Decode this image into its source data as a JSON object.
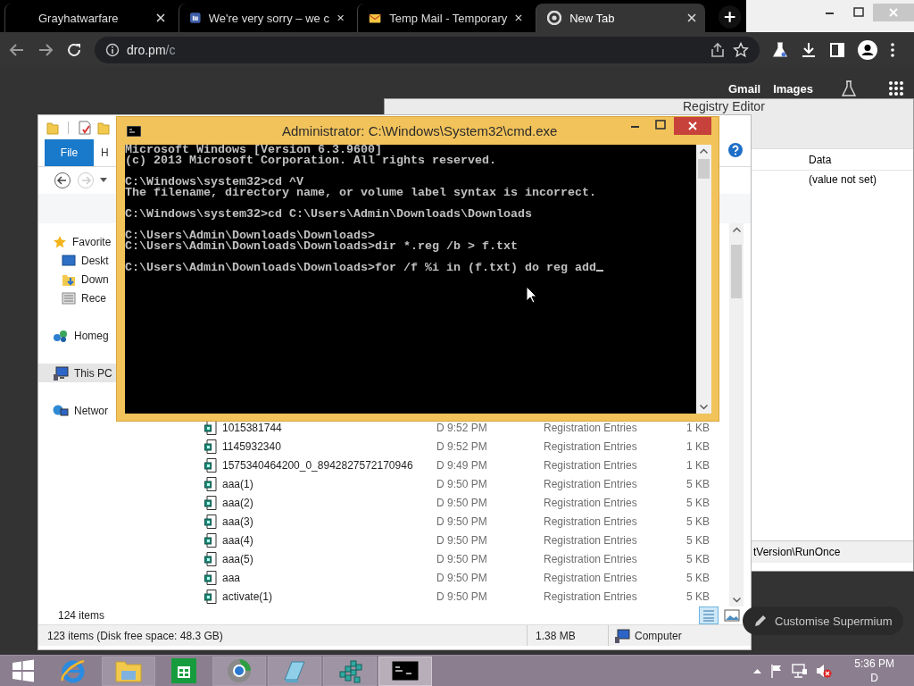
{
  "browser": {
    "tabs": [
      {
        "title": "Grayhatwarfare",
        "kind": "plain",
        "selected": false
      },
      {
        "title": "We're very sorry – we c",
        "kind": "logo",
        "selected": false
      },
      {
        "title": "Temp Mail - Temporary",
        "kind": "mail",
        "selected": false
      },
      {
        "title": "New Tab",
        "kind": "newtab",
        "selected": true
      }
    ],
    "address": {
      "host": "dro.pm",
      "path": "/c"
    },
    "page_links": [
      "Gmail",
      "Images"
    ],
    "customise_button": "Customise Supermium"
  },
  "registry_editor": {
    "title": "Registry Editor",
    "column_header": "Data",
    "value": "(value not set)",
    "status": "tVersion\\RunOnce"
  },
  "explorer": {
    "ribbon_tabs": [
      {
        "label": "File",
        "selected": true
      },
      {
        "label": "H",
        "selected": false
      }
    ],
    "navigation": [
      {
        "label": "Favorite",
        "kind": "favorites",
        "selected": false,
        "children": [
          {
            "label": "Deskt",
            "kind": "desktop",
            "selected": false
          },
          {
            "label": "Down",
            "kind": "downloads",
            "selected": false
          },
          {
            "label": "Rece",
            "kind": "recent",
            "selected": false
          }
        ]
      },
      {
        "label": "Homeg",
        "kind": "homegroup",
        "selected": false
      },
      {
        "label": "This PC",
        "kind": "pc",
        "selected": true
      },
      {
        "label": "Networ",
        "kind": "network",
        "selected": false
      }
    ],
    "files": [
      {
        "name": "1015381744",
        "date": "D 9:52 PM",
        "type": "Registration Entries",
        "size": "1 KB"
      },
      {
        "name": "1145932340",
        "date": "D 9:52 PM",
        "type": "Registration Entries",
        "size": "1 KB"
      },
      {
        "name": "1575340464200_0_8942827572170946",
        "date": "D 9:49 PM",
        "type": "Registration Entries",
        "size": "1 KB"
      },
      {
        "name": "aaa(1)",
        "date": "D 9:50 PM",
        "type": "Registration Entries",
        "size": "5 KB"
      },
      {
        "name": "aaa(2)",
        "date": "D 9:50 PM",
        "type": "Registration Entries",
        "size": "5 KB"
      },
      {
        "name": "aaa(3)",
        "date": "D 9:50 PM",
        "type": "Registration Entries",
        "size": "5 KB"
      },
      {
        "name": "aaa(4)",
        "date": "D 9:50 PM",
        "type": "Registration Entries",
        "size": "5 KB"
      },
      {
        "name": "aaa(5)",
        "date": "D 9:50 PM",
        "type": "Registration Entries",
        "size": "5 KB"
      },
      {
        "name": "aaa",
        "date": "D 9:50 PM",
        "type": "Registration Entries",
        "size": "5 KB"
      },
      {
        "name": "activate(1)",
        "date": "D 9:50 PM",
        "type": "Registration Entries",
        "size": "5 KB"
      }
    ],
    "item_count": "124 items",
    "status": {
      "summary": "123 items (Disk free space: 48.3 GB)",
      "size": "1.38 MB",
      "location": "Computer"
    }
  },
  "cmd": {
    "title": "Administrator: C:\\Windows\\System32\\cmd.exe",
    "blocks": [
      [
        "Microsoft Windows [Version 6.3.9600]",
        "(c) 2013 Microsoft Corporation. All rights reserved."
      ],
      [
        "C:\\Windows\\system32>cd ^V",
        "The filename, directory name, or volume label syntax is incorrect."
      ],
      [
        "C:\\Windows\\system32>cd C:\\Users\\Admin\\Downloads\\Downloads"
      ],
      [
        "C:\\Users\\Admin\\Downloads\\Downloads>",
        "C:\\Users\\Admin\\Downloads\\Downloads>dir *.reg /b > f.txt"
      ],
      [
        "C:\\Users\\Admin\\Downloads\\Downloads>for /f %i in (f.txt) do reg add"
      ]
    ],
    "cursor": true
  },
  "taskbar": {
    "apps": [
      {
        "kind": "ie",
        "open": false,
        "selected": false
      },
      {
        "kind": "explorer",
        "open": true,
        "selected": false
      },
      {
        "kind": "store",
        "open": false,
        "selected": false
      },
      {
        "kind": "browser",
        "open": true,
        "selected": false
      },
      {
        "kind": "notepad",
        "open": true,
        "selected": false
      },
      {
        "kind": "regedit",
        "open": true,
        "selected": false
      },
      {
        "kind": "cmd",
        "open": true,
        "selected": true
      }
    ],
    "time": "5:36 PM",
    "date": "D"
  }
}
